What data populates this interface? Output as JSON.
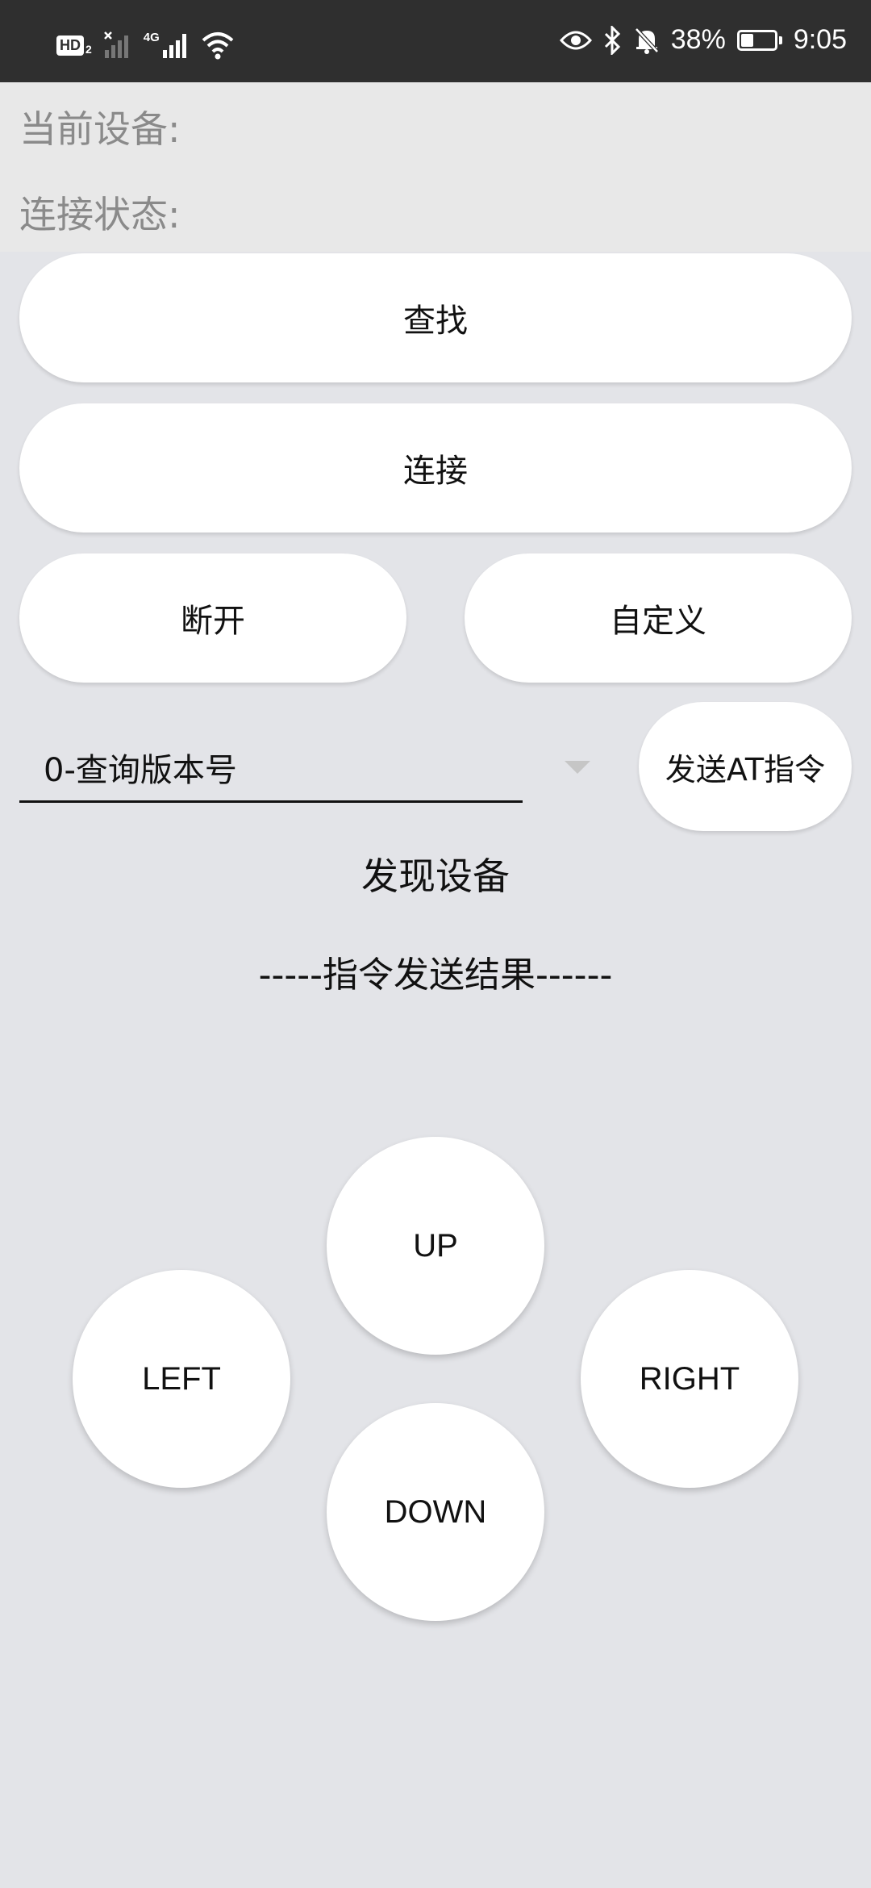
{
  "status_bar": {
    "hd_label": "HD",
    "hd_sub": "2",
    "network_type": "4G",
    "battery_percent": "38%",
    "battery_level": 0.38,
    "time": "9:05",
    "icons": [
      "hd-icon",
      "signal-icon",
      "signal-4g-icon",
      "wifi-icon",
      "eye-icon",
      "bluetooth-icon",
      "bell-off-icon",
      "battery-icon"
    ]
  },
  "device_info": {
    "current_device_label": "当前设备:",
    "connection_status_label": "连接状态:"
  },
  "buttons": {
    "search": "查找",
    "connect": "连接",
    "disconnect": "断开",
    "custom": "自定义",
    "send_at": "发送AT指令"
  },
  "command_select": {
    "selected": "0-查询版本号"
  },
  "discovered_label": "发现设备",
  "result_label": "-----指令发送结果------",
  "dpad": {
    "up": "UP",
    "left": "LEFT",
    "right": "RIGHT",
    "down": "DOWN"
  },
  "colors": {
    "background": "#e3e4e8",
    "status_bar": "#2f2f2f",
    "info_panel": "#e8e8e8",
    "button": "#ffffff",
    "muted_text": "#8a8a8a"
  }
}
